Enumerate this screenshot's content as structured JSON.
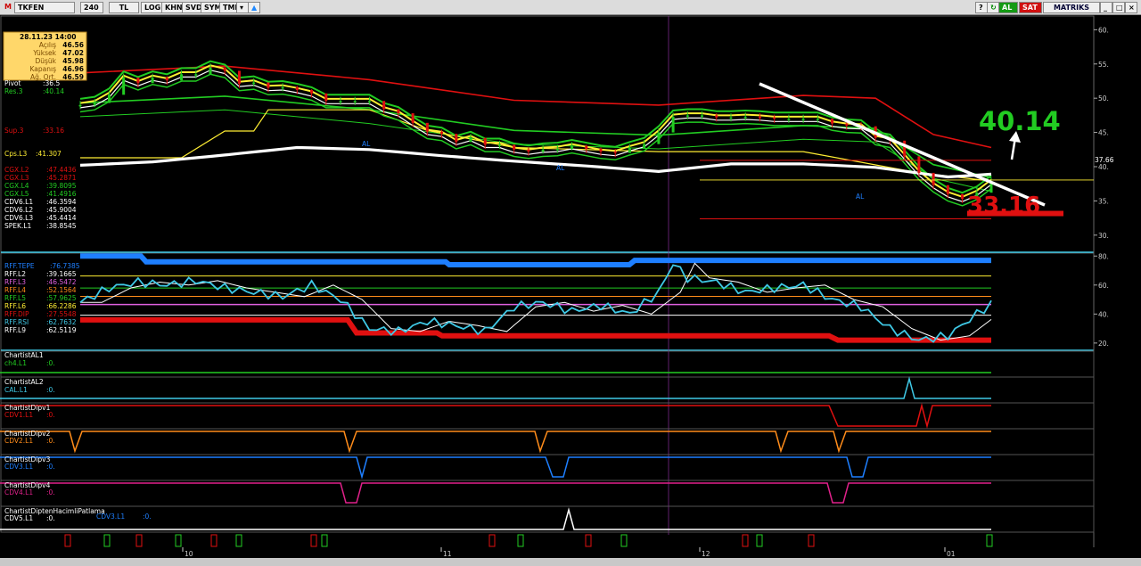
{
  "toolbar": {
    "logo": "M",
    "symbol": "TKFEN",
    "period": "240",
    "currency": "TL",
    "buttons": [
      "LOG",
      "KHN",
      "SVD",
      "SYM",
      "TMP"
    ],
    "buy": "AL",
    "sell": "SAT",
    "brand": "MATRIKS"
  },
  "colors": {
    "bg": "#000000",
    "white": "#ffffff",
    "red": "#e01010",
    "green": "#22cc22",
    "yellow": "#ffee33",
    "blue": "#1e7fff",
    "cyan": "#3fc9e6",
    "orange": "#ff8c1a",
    "magenta": "#e0218a"
  },
  "info_box": {
    "date": "28.11.23 14:00",
    "rows": [
      {
        "label": "Açılış",
        "value": "46.56"
      },
      {
        "label": "Yüksek",
        "value": "47.02"
      },
      {
        "label": "Düşük",
        "value": "45.98"
      },
      {
        "label": "Kapanış",
        "value": "46.96"
      },
      {
        "label": "Ağ. Ort.",
        "value": "46.59"
      }
    ]
  },
  "price_legend": [
    {
      "label": "Pivot",
      "value": ":36.5",
      "color": "#ffffff"
    },
    {
      "label": "Res.3",
      "value": ":40.14",
      "color": "#22cc22"
    },
    {
      "label": "Sup.3",
      "value": ":33.16",
      "color": "#e01010"
    },
    {
      "label": "Cps.L3",
      "value": ":41.307",
      "color": "#ffee33"
    },
    {
      "label": "CGX.L2",
      "value": ":47.4436",
      "color": "#e01010"
    },
    {
      "label": "CGX.L3",
      "value": ":45.2871",
      "color": "#e01010"
    },
    {
      "label": "CGX.L4",
      "value": ":39.8095",
      "color": "#22cc22"
    },
    {
      "label": "CGX.L5",
      "value": ":41.4916",
      "color": "#22cc22"
    },
    {
      "label": "CDV6.L1",
      "value": ":46.3594",
      "color": "#ffffff"
    },
    {
      "label": "CDV6.L2",
      "value": ":45.9004",
      "color": "#ffffff"
    },
    {
      "label": "CDV6.L3",
      "value": ":45.4414",
      "color": "#ffffff"
    },
    {
      "label": "SPEK.L1",
      "value": ":38.8545",
      "color": "#ffffff"
    }
  ],
  "rff_legend": [
    {
      "label": "RFF.TEPE",
      "value": ":76.7385",
      "color": "#1e7fff"
    },
    {
      "label": "RFF.L2",
      "value": ":39.1665",
      "color": "#ffffff"
    },
    {
      "label": "RFF.L3",
      "value": ":46.5472",
      "color": "#e060e0"
    },
    {
      "label": "RFF.L4",
      "value": ":52.1564",
      "color": "#ff8c1a"
    },
    {
      "label": "RFF.L5",
      "value": ":57.9625",
      "color": "#22cc22"
    },
    {
      "label": "RFF.L6",
      "value": ":66.2286",
      "color": "#ffee33"
    },
    {
      "label": "RFF.DIP",
      "value": ":27.5548",
      "color": "#e01010"
    },
    {
      "label": "RFF.RSI",
      "value": ":62.7632",
      "color": "#3fc9e6"
    },
    {
      "label": "RFF.L9",
      "value": ":62.5119",
      "color": "#ffffff"
    }
  ],
  "subpanels": [
    {
      "title": "ChartistAL1",
      "line": "ch4.L1",
      "value": ":0.",
      "color": "#22cc22"
    },
    {
      "title": "ChartistAL2",
      "line": "CAL.L1",
      "value": ":0.",
      "color": "#3fc9e6"
    },
    {
      "title": "ChartistDipv1",
      "line": "CDV1.L1",
      "value": ":0.",
      "color": "#e01010"
    },
    {
      "title": "ChartistDipv2",
      "line": "CDV2.L1",
      "value": ":0.",
      "color": "#ff8c1a"
    },
    {
      "title": "ChartistDipv3",
      "line": "CDV3.L1",
      "value": ":0.",
      "color": "#1e7fff"
    },
    {
      "title": "ChartistDipv4",
      "line": "CDV4.L1",
      "value": ":0.",
      "color": "#e0218a"
    },
    {
      "title": "ChartistDiptenHacimliPatlama",
      "line": "CDV5.L1",
      "value": ":0.",
      "color": "#ffffff",
      "extra_line": "CDV3.L1",
      "extra_value": ":0."
    }
  ],
  "annotations": {
    "target_up": "40.14",
    "target_down": "33.16",
    "current_price_tag": "37.66",
    "al_marker": "AL"
  },
  "chart_data": {
    "type": "line",
    "title": "",
    "price_axis": {
      "ticks": [
        "60.",
        "55.",
        "50.",
        "45.",
        "40.",
        "35.",
        "30."
      ],
      "ylim": [
        27.5,
        62
      ]
    },
    "rff_axis": {
      "ticks": [
        "80.",
        "60.",
        "40.",
        "20."
      ],
      "ylim": [
        15,
        82
      ]
    },
    "x_labels": [
      "10",
      "11",
      "12",
      "01"
    ],
    "levels": {
      "res3": 40.14,
      "sup3": 33.16,
      "last": 37.66
    },
    "series": [
      {
        "name": "Kapanış",
        "x": [
          0,
          4,
          8,
          12,
          16,
          20,
          24,
          28,
          32,
          36,
          40,
          44,
          48,
          52,
          56,
          60,
          64,
          68,
          72,
          76,
          80,
          84,
          88,
          92,
          96,
          100,
          104,
          108,
          112,
          116,
          120,
          124,
          128,
          132,
          136,
          140,
          144,
          148,
          152,
          156,
          160,
          164,
          168,
          172,
          176,
          180,
          184,
          188,
          192,
          196,
          200,
          204,
          208,
          212,
          216,
          220,
          224,
          228,
          232,
          236,
          240,
          244,
          248,
          252
        ],
        "values": [
          49,
          49.3,
          50.5,
          53,
          52.2,
          53,
          52.6,
          53.5,
          53.5,
          54.5,
          54,
          52.1,
          52.3,
          51.5,
          51.6,
          51.2,
          50.7,
          49.6,
          49.6,
          49.6,
          49.6,
          48.4,
          47.8,
          46.4,
          45.1,
          44.8,
          43.6,
          44.2,
          43.2,
          43.2,
          42.5,
          42.2,
          42.5,
          42.6,
          43,
          42.6,
          42.2,
          42,
          42.7,
          43.3,
          45,
          47.3,
          47.5,
          47.5,
          47.2,
          47.2,
          47.3,
          47.2,
          47,
          47,
          47,
          47,
          46.3,
          46,
          45.9,
          44.2,
          43.8,
          41.5,
          39.1,
          37.3,
          36,
          35.3,
          36.2,
          37.8
        ]
      },
      {
        "name": "SPEK.L1",
        "x": [
          0,
          20,
          40,
          60,
          80,
          100,
          120,
          140,
          160,
          180,
          200,
          220,
          240,
          252
        ],
        "values": [
          40.2,
          40.7,
          41.7,
          42.8,
          42.5,
          41.6,
          40.8,
          40.1,
          39.3,
          40.4,
          40.4,
          39.9,
          38.5,
          38.9
        ]
      },
      {
        "name": "RFF.RSI",
        "x": [
          0,
          8,
          16,
          24,
          32,
          40,
          48,
          56,
          64,
          72,
          80,
          88,
          96,
          104,
          112,
          120,
          128,
          136,
          144,
          152,
          160,
          164,
          168,
          176,
          184,
          192,
          200,
          208,
          216,
          224,
          232,
          240,
          248,
          252
        ],
        "values": [
          48,
          58,
          62,
          60,
          63,
          58,
          55,
          52,
          60,
          50,
          30,
          28,
          35,
          32,
          28,
          45,
          48,
          42,
          46,
          40,
          55,
          75,
          65,
          62,
          55,
          58,
          60,
          50,
          45,
          30,
          22,
          25,
          40,
          47
        ]
      }
    ]
  }
}
